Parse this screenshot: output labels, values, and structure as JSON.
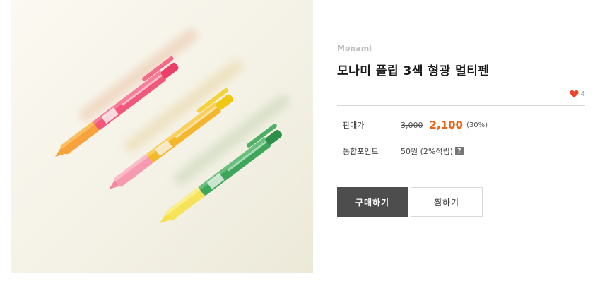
{
  "product": {
    "image_alt": "Monami flip 3-color pens",
    "brand": "Monami",
    "title": "모나미 플립 3색 형광 멀티펜",
    "likes": "4"
  },
  "price": {
    "label": "판매가",
    "original": "3,000",
    "sale": "2,100",
    "discount": "(30%)"
  },
  "points": {
    "label": "통합포인트",
    "value": "50원 (2%적립)",
    "help": "?"
  },
  "actions": {
    "buy": "구매하기",
    "wish": "찜하기"
  },
  "colors": {
    "heart": "#e8452a",
    "sale_price": "#e8651a",
    "buy_button": "#4d4d4d"
  }
}
